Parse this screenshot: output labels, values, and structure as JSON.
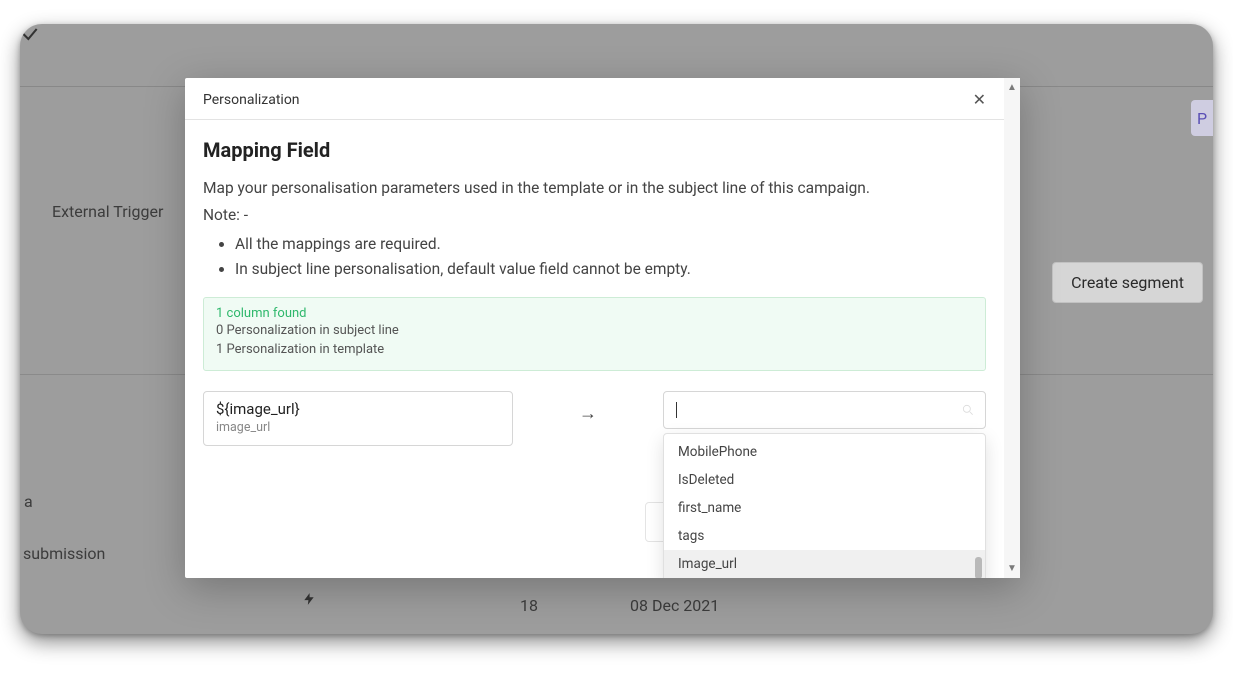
{
  "background": {
    "external_trigger": "External Trigger",
    "row_a": "a",
    "row_submission": "submission",
    "count": "18",
    "date": "08 Dec 2021",
    "create_segment": "Create segment",
    "corner_letter": "P"
  },
  "modal": {
    "header_title": "Personalization",
    "title": "Mapping Field",
    "description": "Map your personalisation parameters used in the template or in the subject line of this campaign.",
    "note_label": "Note: -",
    "bullets": [
      "All the mappings are required.",
      "In subject line personalisation, default value field cannot be empty."
    ],
    "info": {
      "found": "1 column found",
      "subject": "0 Personalization in subject line",
      "template": "1 Personalization in template"
    },
    "mapping": {
      "variable": "${image_url}",
      "name": "image_url"
    },
    "dropdown": {
      "options": [
        "MobilePhone",
        "IsDeleted",
        "first_name",
        "tags",
        "Image_url"
      ],
      "highlighted": "Image_url"
    }
  }
}
